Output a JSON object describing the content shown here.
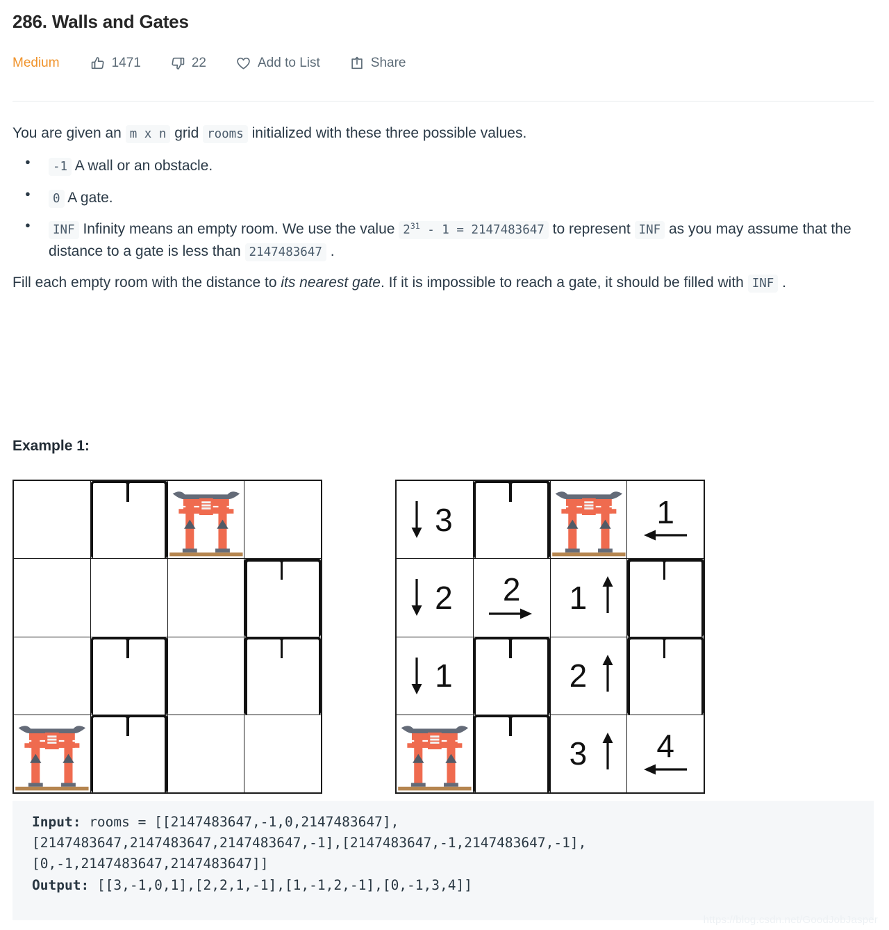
{
  "header": {
    "title": "286. Walls and Gates",
    "difficulty": "Medium",
    "likes": "1471",
    "dislikes": "22",
    "add_to_list": "Add to List",
    "share": "Share",
    "accent_color": "#f0932b",
    "meta_color": "#5c6b77"
  },
  "description": {
    "intro_1": "You are given an ",
    "code_mxn": "m x n",
    "intro_2": " grid ",
    "code_rooms": "rooms",
    "intro_3": " initialized with these three possible values.",
    "bullets": [
      {
        "code": "-1",
        "text": " A wall or an obstacle."
      },
      {
        "code": "0",
        "text": " A gate."
      }
    ],
    "bullet3": {
      "code_inf": "INF",
      "text_1": " Infinity means an empty room. We use the value ",
      "code_value_base": "2",
      "code_value_exp": "31",
      "code_value_rest": " - 1 = 2147483647",
      "text_2": " to represent ",
      "code_inf2": "INF",
      "text_3": " as you may assume that the distance to a gate is less than ",
      "code_max": "2147483647",
      "text_4": " ."
    },
    "para2_1": "Fill each empty room with the distance to ",
    "para2_italic": "its nearest gate",
    "para2_2": ". If it is impossible to reach a gate, it should be filled with ",
    "code_inf3": "INF",
    "para2_3": " ."
  },
  "example": {
    "label": "Example 1:",
    "input_grid": {
      "caption": "input rooms grid",
      "cells": [
        [
          {
            "type": "empty"
          },
          {
            "type": "wall"
          },
          {
            "type": "gate"
          },
          {
            "type": "empty"
          }
        ],
        [
          {
            "type": "empty"
          },
          {
            "type": "empty"
          },
          {
            "type": "empty"
          },
          {
            "type": "wall"
          }
        ],
        [
          {
            "type": "empty"
          },
          {
            "type": "wall"
          },
          {
            "type": "empty"
          },
          {
            "type": "wall"
          }
        ],
        [
          {
            "type": "gate"
          },
          {
            "type": "wall"
          },
          {
            "type": "empty"
          },
          {
            "type": "empty"
          }
        ]
      ]
    },
    "output_grid": {
      "caption": "output distances grid",
      "cells": [
        [
          {
            "type": "num",
            "value": "3",
            "arrow": "down"
          },
          {
            "type": "wall"
          },
          {
            "type": "gate"
          },
          {
            "type": "num",
            "value": "1",
            "arrow": "left"
          }
        ],
        [
          {
            "type": "num",
            "value": "2",
            "arrow": "down"
          },
          {
            "type": "num",
            "value": "2",
            "arrow": "right"
          },
          {
            "type": "num",
            "value": "1",
            "arrow": "up"
          },
          {
            "type": "wall"
          }
        ],
        [
          {
            "type": "num",
            "value": "1",
            "arrow": "down"
          },
          {
            "type": "wall"
          },
          {
            "type": "num",
            "value": "2",
            "arrow": "up"
          },
          {
            "type": "wall"
          }
        ],
        [
          {
            "type": "gate"
          },
          {
            "type": "wall"
          },
          {
            "type": "num",
            "value": "3",
            "arrow": "up"
          },
          {
            "type": "num",
            "value": "4",
            "arrow": "left"
          }
        ]
      ]
    }
  },
  "code_block": {
    "input_label": "Input:",
    "input_line1": " rooms = [[2147483647,-1,0,2147483647],",
    "input_line2": "[2147483647,2147483647,2147483647,-1],[2147483647,-1,2147483647,-1],",
    "input_line3": "[0,-1,2147483647,2147483647]]",
    "output_label": "Output:",
    "output_value": " [[3,-1,0,1],[2,2,1,-1],[1,-1,2,-1],[0,-1,3,4]]"
  },
  "watermark": "https://blog.csdn.net/GoodJobJasper"
}
